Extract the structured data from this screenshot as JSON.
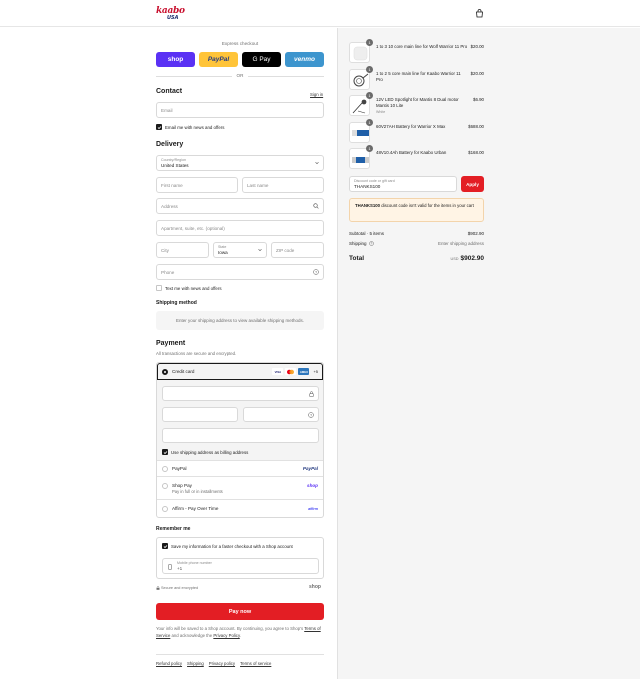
{
  "brand": {
    "logo_main": "kaabo",
    "logo_sub": "USA"
  },
  "express": {
    "title": "Express checkout",
    "shop_label": "shop",
    "paypal_label": "PayPal",
    "gpay_label": "G Pay",
    "venmo_label": "venmo",
    "or_label": "OR"
  },
  "contact": {
    "heading": "Contact",
    "sign_in": "Sign in",
    "email_placeholder": "Email",
    "news_checkbox": "Email me with news and offers"
  },
  "delivery": {
    "heading": "Delivery",
    "country_label": "Country/Region",
    "country_value": "United States",
    "first_name": "First name",
    "last_name": "Last name",
    "address": "Address",
    "apartment": "Apartment, suite, etc. (optional)",
    "city": "City",
    "state_label": "State",
    "state_value": "Iowa",
    "zip": "ZIP code",
    "phone": "Phone",
    "text_checkbox": "Text me with news and offers"
  },
  "shipping": {
    "heading": "Shipping method",
    "info": "Enter your shipping address to view available shipping methods."
  },
  "payment": {
    "heading": "Payment",
    "subtext": "All transactions are secure and encrypted.",
    "credit_card": "Credit card",
    "brands": [
      "VISA",
      "MC",
      "AMEX"
    ],
    "more_brands": "+5",
    "billing_checkbox": "Use shipping address as billing address",
    "paypal": "PayPal",
    "paypal_logo": "PayPal",
    "shop_pay": "Shop Pay",
    "shop_pay_sub": "Pay in full or in installments",
    "shop_pay_logo": "shop",
    "affirm": "Affirm - Pay Over Time",
    "affirm_logo": "affirm"
  },
  "remember": {
    "heading": "Remember me",
    "save_checkbox": "Save my information for a faster checkout with a Shop account",
    "mobile_label": "Mobile phone number",
    "mobile_value": "+1",
    "secure": "Secure and encrypted",
    "shop_logo": "shop"
  },
  "pay_now": "Pay now",
  "fine_print": {
    "part1": "Your info will be saved to a Shop account. By continuing, you agree to Shop's ",
    "terms": "Terms of Service",
    "part2": " and acknowledge the ",
    "privacy": "Privacy Policy",
    "part3": "."
  },
  "footer": {
    "refund": "Refund policy",
    "shipping": "Shipping",
    "privacy": "Privacy policy",
    "terms": "Terms of service"
  },
  "order": {
    "items": [
      {
        "qty": "1",
        "name": "1 to 3 10 core main line for Wolf Warrior 11 Pro",
        "variant": "",
        "price": "$20.00"
      },
      {
        "qty": "1",
        "name": "1 to 2 5 core main line for Kaabo Warrior 11 Pro",
        "variant": "",
        "price": "$20.00"
      },
      {
        "qty": "1",
        "name": "12V LED Spotlight for Mantis 8 Dual motor Mantis 10 Lite",
        "variant": "White",
        "price": "$6.90"
      },
      {
        "qty": "1",
        "name": "60V27AH Battery for Warrior X Max",
        "variant": "",
        "price": "$688.00"
      },
      {
        "qty": "1",
        "name": "48V10.4Ah Battery for Kaabo Urban",
        "variant": "",
        "price": "$168.00"
      }
    ],
    "discount_label": "Discount code or gift card",
    "discount_value": "THANKS100",
    "apply": "Apply",
    "warning_code": "THANKS100",
    "warning_text": " discount code isn't valid for the items in your cart",
    "subtotal_label": "Subtotal · 5 items",
    "subtotal_value": "$902.90",
    "shipping_label": "Shipping",
    "shipping_value": "Enter shipping address",
    "total_label": "Total",
    "currency": "USD",
    "total_value": "$902.90"
  }
}
